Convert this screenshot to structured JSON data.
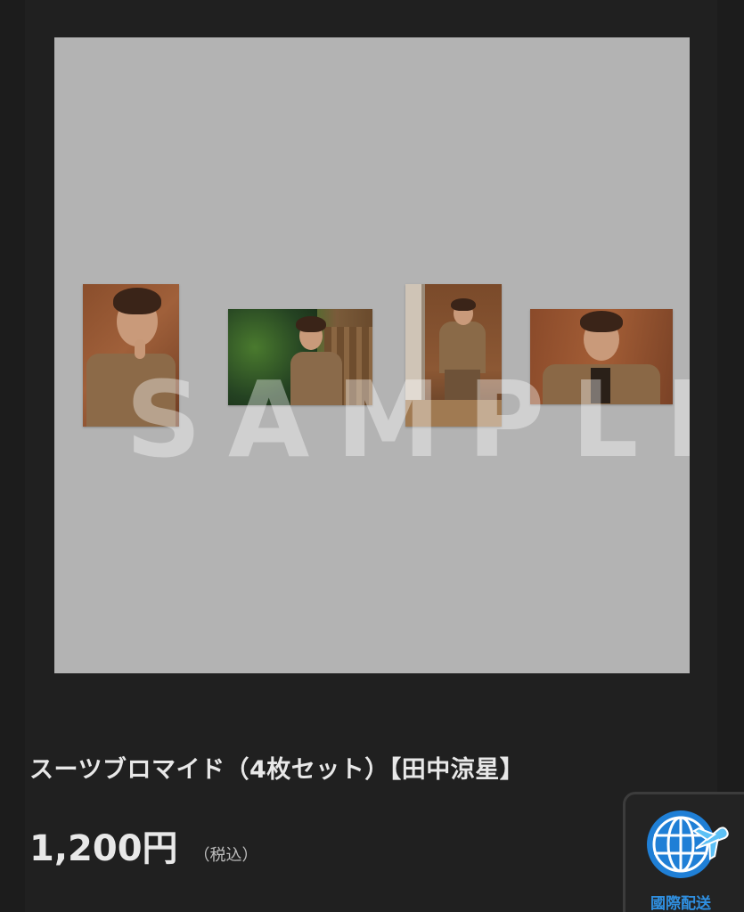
{
  "product": {
    "title": "スーツブロマイド（4枚セット）【田中涼星】",
    "price": "1,200円",
    "tax_note": "（税込）",
    "image": {
      "watermark": "SAMPLE",
      "photos": [
        {
          "name": "photo-1",
          "orientation": "portrait"
        },
        {
          "name": "photo-2",
          "orientation": "landscape"
        },
        {
          "name": "photo-3",
          "orientation": "portrait"
        },
        {
          "name": "photo-4",
          "orientation": "landscape"
        }
      ]
    }
  },
  "international_shipping": {
    "label": "國際配送",
    "icon": "globe-plane-icon",
    "color": "#2f8fe0"
  },
  "colors": {
    "page_background": "#1c1c1c",
    "panel_background": "#202020",
    "image_background": "#b3b3b3",
    "text_primary": "#e8e8e8",
    "accent_blue": "#2f8fe0"
  }
}
